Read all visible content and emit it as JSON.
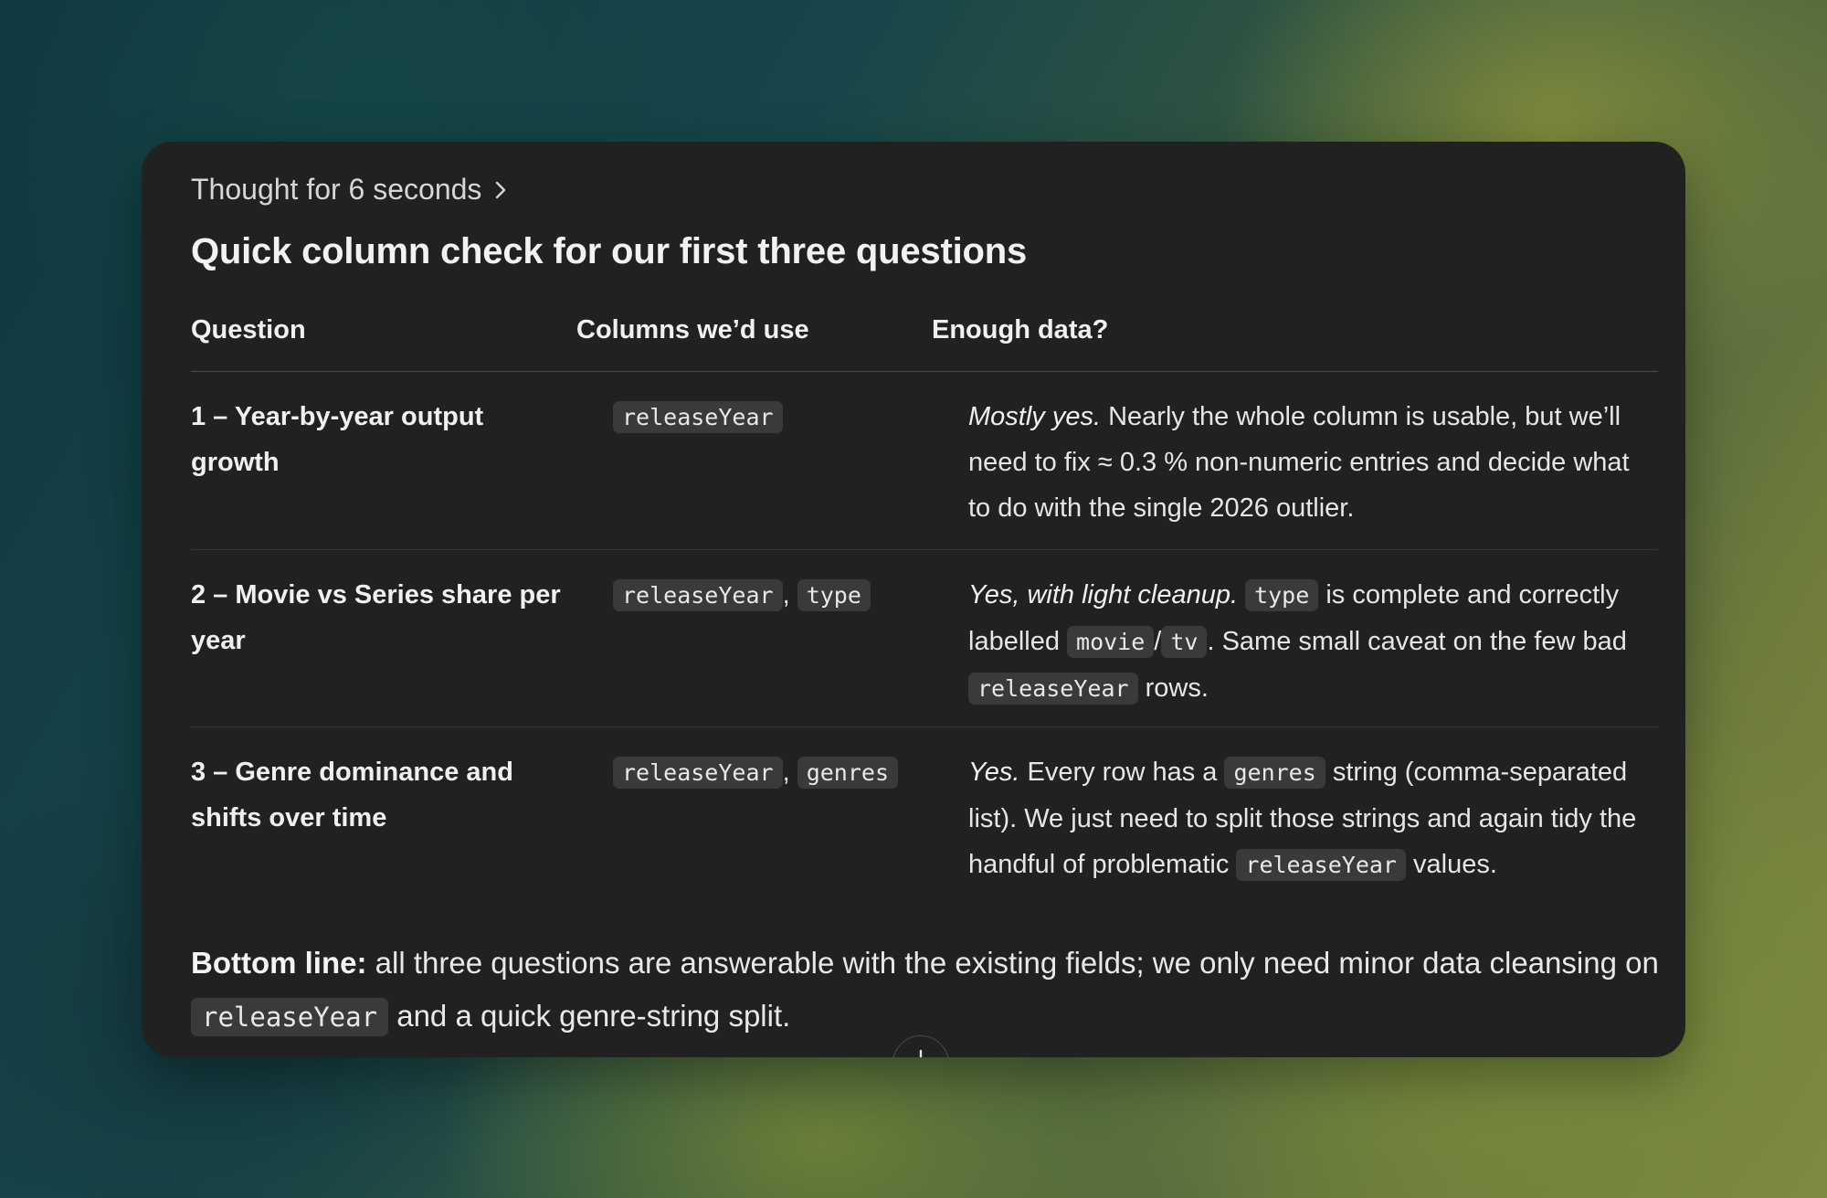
{
  "thought": {
    "label": "Thought for 6 seconds",
    "icon": "chevron-right-icon"
  },
  "heading": "Quick column check for our first three questions",
  "table": {
    "headers": [
      "Question",
      "Columns we’d use",
      "Enough data?"
    ],
    "rows": [
      {
        "question": "1 – Year-by-year output growth",
        "columns": [
          "releaseYear"
        ],
        "answer": {
          "verdict": "Mostly yes.",
          "text": " Nearly the whole column is usable, but we’ll need to fix ≈ 0.3 % non-numeric entries and decide what to do with the single 2026 outlier."
        }
      },
      {
        "question": "2 – Movie vs Series share per year",
        "columns": [
          "releaseYear",
          "type"
        ],
        "answer": {
          "verdict": "Yes, with light cleanup.",
          "code1": "type",
          "text1": " is complete and correctly labelled ",
          "code2": "movie",
          "slash": "/",
          "code3": "tv",
          "text2": ". Same small caveat on the few bad ",
          "code4": "releaseYear",
          "text3": " rows."
        }
      },
      {
        "question": "3 – Genre dominance and shifts over time",
        "columns": [
          "releaseYear",
          "genres"
        ],
        "answer": {
          "verdict": "Yes.",
          "text1": " Every row has a ",
          "code1": "genres",
          "text2": " string (comma-separated list). We just need to split those strings and again tidy the handful of problematic ",
          "code2": "releaseYear",
          "text3": " values."
        }
      }
    ],
    "column_separator": ","
  },
  "bottom_line": {
    "label": "Bottom line:",
    "text1": " all three questions are answerable with the existing fields; we only need minor data cleansing on ",
    "code": "releaseYear",
    "text2": " and a quick genre-string split."
  },
  "scroll_button": {
    "icon": "arrow-down-icon"
  }
}
